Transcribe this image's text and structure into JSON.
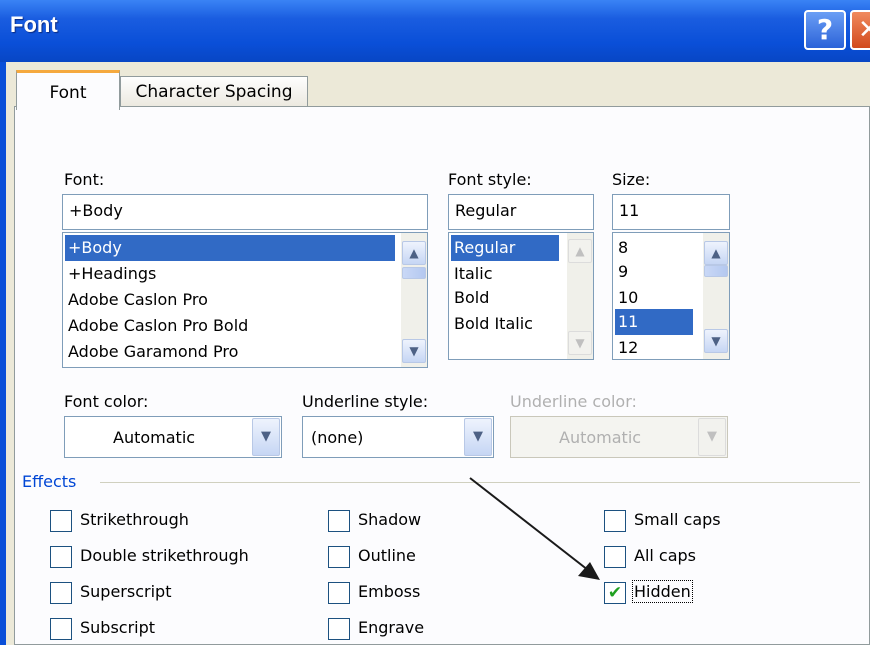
{
  "window": {
    "title": "Font",
    "help_glyph": "?",
    "close_glyph": "✕"
  },
  "tabs": [
    {
      "label": "Font",
      "active": true
    },
    {
      "label": "Character Spacing",
      "active": false
    }
  ],
  "font": {
    "label": "Font:",
    "value": "+Body",
    "items": [
      "+Body",
      "+Headings",
      "Adobe Caslon Pro",
      "Adobe Caslon Pro Bold",
      "Adobe Garamond Pro"
    ],
    "selected": "+Body"
  },
  "font_style": {
    "label": "Font style:",
    "value": "Regular",
    "items": [
      "Regular",
      "Italic",
      "Bold",
      "Bold Italic"
    ],
    "selected": "Regular"
  },
  "size": {
    "label": "Size:",
    "value": "11",
    "items": [
      "8",
      "9",
      "10",
      "11",
      "12"
    ],
    "selected": "11"
  },
  "font_color": {
    "label": "Font color:",
    "value": "Automatic"
  },
  "underline_style": {
    "label": "Underline style:",
    "value": "(none)"
  },
  "underline_color": {
    "label": "Underline color:",
    "value": "Automatic",
    "disabled": true
  },
  "effects": {
    "label": "Effects",
    "col1": [
      {
        "label": "Strikethrough",
        "checked": false
      },
      {
        "label": "Double strikethrough",
        "checked": false
      },
      {
        "label": "Superscript",
        "checked": false
      },
      {
        "label": "Subscript",
        "checked": false
      }
    ],
    "col2": [
      {
        "label": "Shadow",
        "checked": false
      },
      {
        "label": "Outline",
        "checked": false
      },
      {
        "label": "Emboss",
        "checked": false
      },
      {
        "label": "Engrave",
        "checked": false
      }
    ],
    "col3": [
      {
        "label": "Small caps",
        "checked": false
      },
      {
        "label": "All caps",
        "checked": false
      },
      {
        "label": "Hidden",
        "checked": true
      }
    ]
  },
  "icons": {
    "scroll_up": "▲",
    "scroll_down": "▼",
    "dropdown": "▼",
    "check": "✔"
  },
  "colors": {
    "titlebar": "#0a4fd8",
    "selection": "#316ac5",
    "group_label": "#0046d5",
    "tab_highlight": "#f5a93e"
  }
}
